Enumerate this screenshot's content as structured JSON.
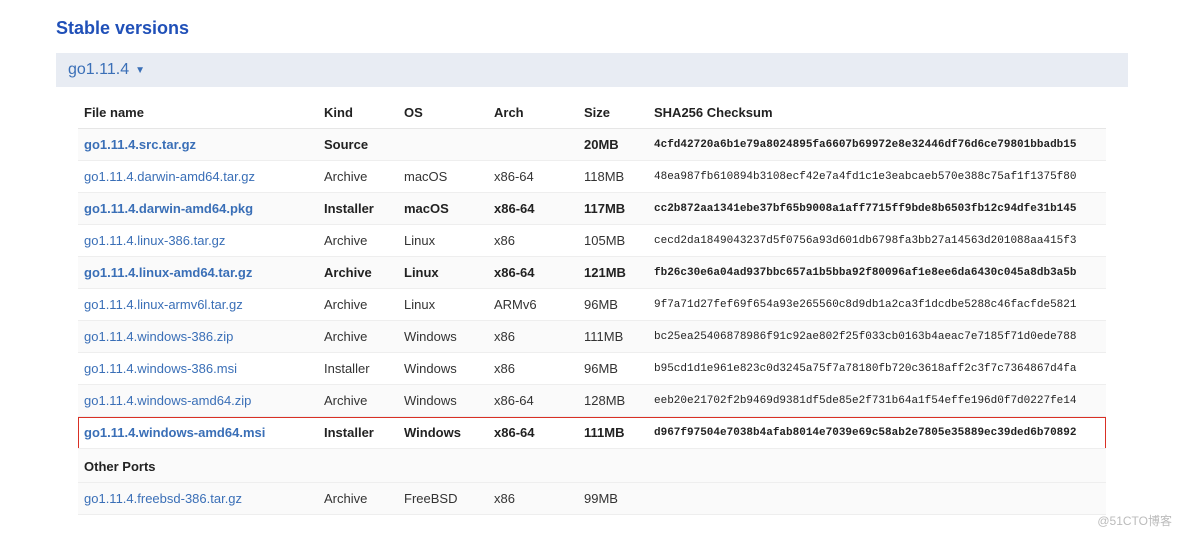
{
  "heading": "Stable versions",
  "version_selector": "go1.11.4",
  "columns": {
    "file": "File name",
    "kind": "Kind",
    "os": "OS",
    "arch": "Arch",
    "size": "Size",
    "chk": "SHA256 Checksum"
  },
  "rows": [
    {
      "file": "go1.11.4.src.tar.gz",
      "kind": "Source",
      "os": "",
      "arch": "",
      "size": "20MB",
      "chk": "4cfd42720a6b1e79a8024895fa6607b69972e8e32446df76d6ce79801bbadb15",
      "bold": true,
      "hl": false
    },
    {
      "file": "go1.11.4.darwin-amd64.tar.gz",
      "kind": "Archive",
      "os": "macOS",
      "arch": "x86-64",
      "size": "118MB",
      "chk": "48ea987fb610894b3108ecf42e7a4fd1c1e3eabcaeb570e388c75af1f1375f80",
      "bold": false,
      "hl": false
    },
    {
      "file": "go1.11.4.darwin-amd64.pkg",
      "kind": "Installer",
      "os": "macOS",
      "arch": "x86-64",
      "size": "117MB",
      "chk": "cc2b872aa1341ebe37bf65b9008a1aff7715ff9bde8b6503fb12c94dfe31b145",
      "bold": true,
      "hl": false
    },
    {
      "file": "go1.11.4.linux-386.tar.gz",
      "kind": "Archive",
      "os": "Linux",
      "arch": "x86",
      "size": "105MB",
      "chk": "cecd2da1849043237d5f0756a93d601db6798fa3bb27a14563d201088aa415f3",
      "bold": false,
      "hl": false
    },
    {
      "file": "go1.11.4.linux-amd64.tar.gz",
      "kind": "Archive",
      "os": "Linux",
      "arch": "x86-64",
      "size": "121MB",
      "chk": "fb26c30e6a04ad937bbc657a1b5bba92f80096af1e8ee6da6430c045a8db3a5b",
      "bold": true,
      "hl": false
    },
    {
      "file": "go1.11.4.linux-armv6l.tar.gz",
      "kind": "Archive",
      "os": "Linux",
      "arch": "ARMv6",
      "size": "96MB",
      "chk": "9f7a71d27fef69f654a93e265560c8d9db1a2ca3f1dcdbe5288c46facfde5821",
      "bold": false,
      "hl": false
    },
    {
      "file": "go1.11.4.windows-386.zip",
      "kind": "Archive",
      "os": "Windows",
      "arch": "x86",
      "size": "111MB",
      "chk": "bc25ea25406878986f91c92ae802f25f033cb0163b4aeac7e7185f71d0ede788",
      "bold": false,
      "hl": false
    },
    {
      "file": "go1.11.4.windows-386.msi",
      "kind": "Installer",
      "os": "Windows",
      "arch": "x86",
      "size": "96MB",
      "chk": "b95cd1d1e961e823c0d3245a75f7a78180fb720c3618aff2c3f7c7364867d4fa",
      "bold": false,
      "hl": false
    },
    {
      "file": "go1.11.4.windows-amd64.zip",
      "kind": "Archive",
      "os": "Windows",
      "arch": "x86-64",
      "size": "128MB",
      "chk": "eeb20e21702f2b9469d9381df5de85e2f731b64a1f54effe196d0f7d0227fe14",
      "bold": false,
      "hl": false
    },
    {
      "file": "go1.11.4.windows-amd64.msi",
      "kind": "Installer",
      "os": "Windows",
      "arch": "x86-64",
      "size": "111MB",
      "chk": "d967f97504e7038b4afab8014e7039e69c58ab2e7805e35889ec39ded6b70892",
      "bold": true,
      "hl": true
    }
  ],
  "sub_heading": "Other Ports",
  "extra_rows": [
    {
      "file": "go1.11.4.freebsd-386.tar.gz",
      "kind": "Archive",
      "os": "FreeBSD",
      "arch": "x86",
      "size": "99MB",
      "chk": "",
      "bold": false,
      "hl": false
    }
  ],
  "watermark": "@51CTO博客"
}
